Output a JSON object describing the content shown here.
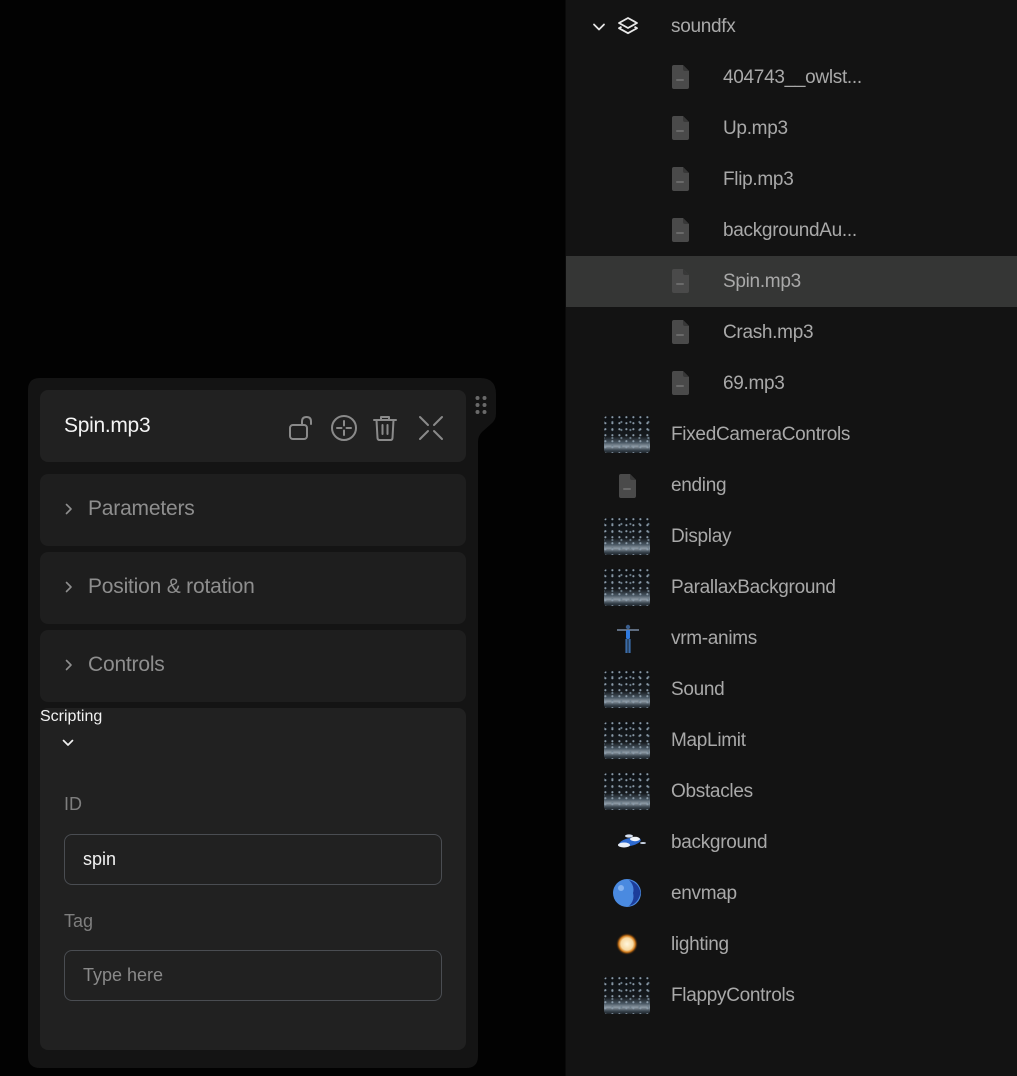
{
  "tree": {
    "folder": {
      "label": "soundfx",
      "expanded": true,
      "icon": "layers-icon"
    },
    "folder_items": [
      {
        "label": "404743__owlst...",
        "icon": "audio-file-icon",
        "selected": false
      },
      {
        "label": "Up.mp3",
        "icon": "audio-file-icon",
        "selected": false
      },
      {
        "label": "Flip.mp3",
        "icon": "audio-file-icon",
        "selected": false
      },
      {
        "label": "backgroundAu...",
        "icon": "audio-file-icon",
        "selected": false
      },
      {
        "label": "Spin.mp3",
        "icon": "audio-file-icon",
        "selected": true
      },
      {
        "label": "Crash.mp3",
        "icon": "audio-file-icon",
        "selected": false
      },
      {
        "label": "69.mp3",
        "icon": "audio-file-icon",
        "selected": false
      }
    ],
    "items": [
      {
        "label": "FixedCameraControls",
        "icon": "scene-thumbnail"
      },
      {
        "label": "ending",
        "icon": "audio-file-icon"
      },
      {
        "label": "Display",
        "icon": "scene-thumbnail"
      },
      {
        "label": "ParallaxBackground",
        "icon": "scene-thumbnail"
      },
      {
        "label": "vrm-anims",
        "icon": "avatar-model-thumbnail"
      },
      {
        "label": "Sound",
        "icon": "scene-thumbnail"
      },
      {
        "label": "MapLimit",
        "icon": "scene-thumbnail"
      },
      {
        "label": "Obstacles",
        "icon": "scene-thumbnail"
      },
      {
        "label": "background",
        "icon": "clouds-thumbnail"
      },
      {
        "label": "envmap",
        "icon": "globe-thumbnail"
      },
      {
        "label": "lighting",
        "icon": "sun-thumbnail"
      },
      {
        "label": "FlappyControls",
        "icon": "scene-thumbnail"
      }
    ]
  },
  "inspector": {
    "title": "Spin.mp3",
    "actions": [
      {
        "name": "unlock",
        "icon": "unlock-icon"
      },
      {
        "name": "focus",
        "icon": "crosshair-icon"
      },
      {
        "name": "delete",
        "icon": "trash-icon"
      },
      {
        "name": "collapse",
        "icon": "collapse-icon"
      }
    ],
    "sections": [
      {
        "label": "Parameters",
        "expanded": false
      },
      {
        "label": "Position & rotation",
        "expanded": false
      },
      {
        "label": "Controls",
        "expanded": false
      }
    ],
    "scripting": {
      "label": "Scripting",
      "expanded": true,
      "id_label": "ID",
      "id_value": "spin",
      "tag_label": "Tag",
      "tag_value": "",
      "tag_placeholder": "Type here"
    }
  },
  "colors": {
    "tree_bg": "#131313",
    "selected_row": "#353635",
    "panel_bg": "#141414",
    "card_bg": "#1e1e1e",
    "text_primary": "#f4f4f4",
    "text_secondary": "#a9a9a9"
  }
}
